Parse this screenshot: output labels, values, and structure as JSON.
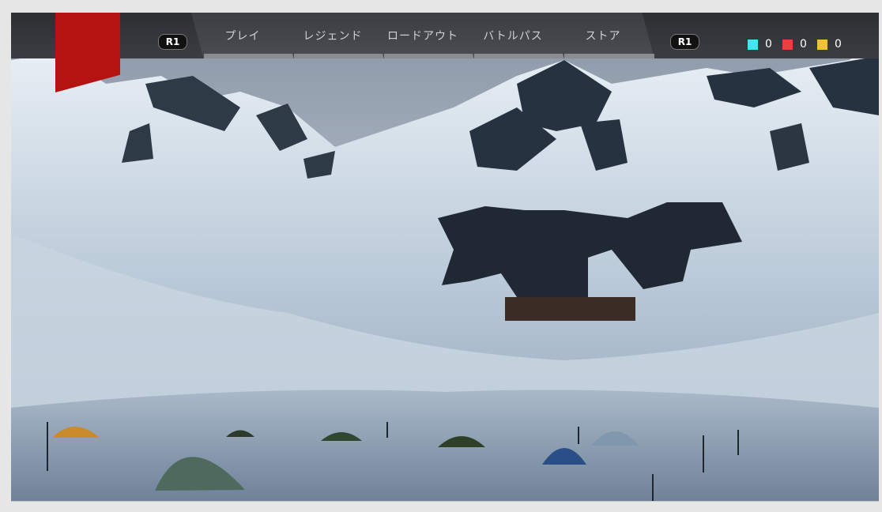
{
  "nav": {
    "left_shoulder": "R1",
    "right_shoulder": "R1",
    "tabs": [
      {
        "label": "プレイ"
      },
      {
        "label": "レジェンド"
      },
      {
        "label": "ロードアウト"
      },
      {
        "label": "バトルパス"
      },
      {
        "label": "ストア"
      }
    ]
  },
  "currencies": [
    {
      "color": "#3fe8f0",
      "amount": "0"
    },
    {
      "color": "#e8403f",
      "amount": "0"
    },
    {
      "color": "#f1c232",
      "amount": "0"
    }
  ],
  "colors": {
    "accent_flag": "#b51212",
    "bar_bg": "#2d2f33"
  }
}
